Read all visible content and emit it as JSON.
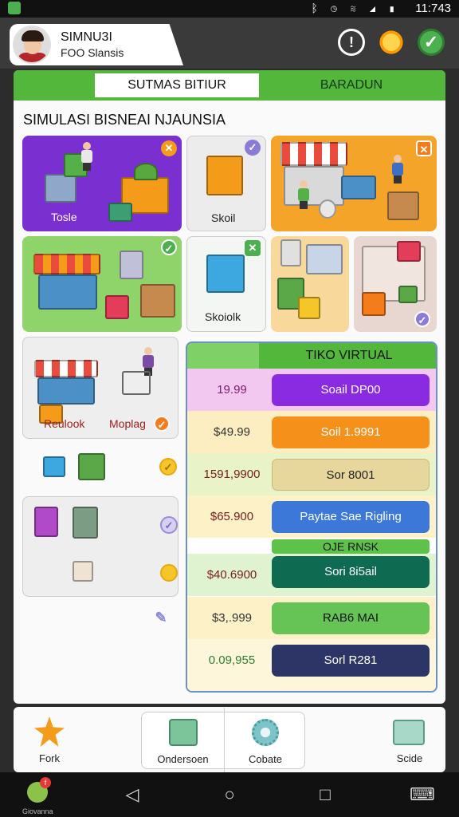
{
  "status": {
    "time": "11:743",
    "icons": "ᛒ ◷ ≋ ◢ ▮"
  },
  "header": {
    "name": "SIMNU3I",
    "subtitle": "FOO Slansis",
    "info_icon": "info-icon",
    "sun_icon": "sun-icon",
    "check_icon": "check-icon"
  },
  "tabs": [
    {
      "label": "SUTMAS BITIUR"
    },
    {
      "label": "BARADUN"
    }
  ],
  "title": "SIMULASI BISNEAI NJAUNSIA",
  "tiles": {
    "tosle": "Tosle",
    "skoil": "Skoil",
    "skoiolk": "Skoiolk",
    "reulook": "Reulook",
    "moplag": "Moplag"
  },
  "shop": {
    "title": "TIKO VIRTUAL",
    "divider": "OJE RNSK",
    "rows": [
      {
        "price": "19.99",
        "button": "Soail DP00"
      },
      {
        "price": "$49.99",
        "button": "Soil 1.9991"
      },
      {
        "price": "1591,9900",
        "button": "Sor 8001"
      },
      {
        "price": "$65.900",
        "button": "Paytae Sae Rigling"
      },
      {
        "price": "$40.6900",
        "button": "Sori 8i5ail"
      },
      {
        "price": "$3,.999",
        "button": "RAB6 MAI"
      },
      {
        "price": "0.09,955",
        "button": "Sorl R281"
      }
    ]
  },
  "nav": {
    "fork": "Fork",
    "ondersoen": "Ondersoen",
    "cobate": "Cobate",
    "scide": "Scide"
  },
  "app_label": "Giovanna",
  "colors": {
    "green": "#52b73b",
    "purple": "#7a2fd0",
    "orange": "#f59b1a"
  }
}
